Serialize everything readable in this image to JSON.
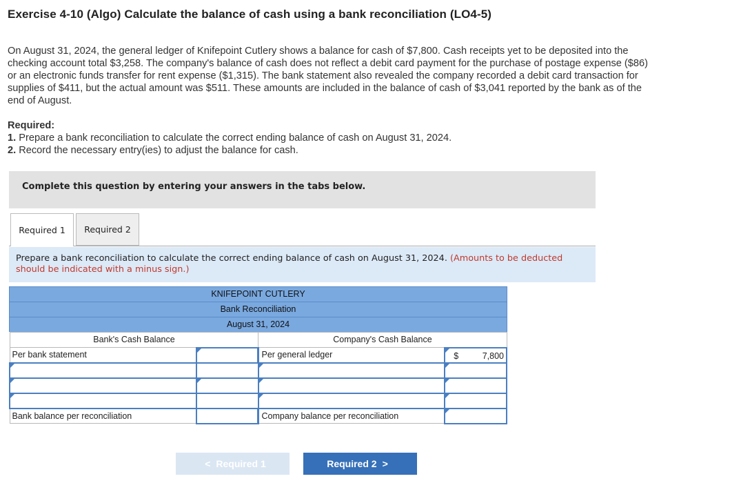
{
  "title": "Exercise 4-10 (Algo) Calculate the balance of cash using a bank reconciliation (LO4-5)",
  "problem_text": "On August 31, 2024, the general ledger of Knifepoint Cutlery shows a balance for cash of $7,800. Cash receipts yet to be deposited into the checking account total $3,258. The company's balance of cash does not reflect a debit card payment for the purchase of postage expense ($86) or an electronic funds transfer for rent expense ($1,315). The bank statement also revealed the company recorded a debit card transaction for supplies of $411, but the actual amount was $511. These amounts are included in the balance of cash of $3,041 reported by the bank as of the end of August.",
  "required": {
    "heading": "Required:",
    "item1_num": "1.",
    "item1": "Prepare a bank reconciliation to calculate the correct ending balance of cash on August 31, 2024.",
    "item2_num": "2.",
    "item2": "Record the necessary entry(ies) to adjust the balance for cash."
  },
  "banner": "Complete this question by entering your answers in the tabs below.",
  "tabs": [
    {
      "label": "Required 1"
    },
    {
      "label": "Required 2"
    }
  ],
  "instruction": {
    "text": "Prepare a bank reconciliation to calculate the correct ending balance of cash on August 31, 2024.",
    "note": "(Amounts to be deducted should be indicated with a minus sign.)"
  },
  "reconciliation": {
    "company": "KNIFEPOINT CUTLERY",
    "heading": "Bank Reconciliation",
    "date": "August 31, 2024",
    "bank_col": "Bank's Cash Balance",
    "company_col": "Company's Cash Balance",
    "bank_first_label": "Per bank statement",
    "company_first_label": "Per general ledger",
    "company_first_currency": "$",
    "company_first_value": "7,800",
    "bank_total_label": "Bank balance per reconciliation",
    "company_total_label": "Company balance per reconciliation"
  },
  "nav": {
    "prev": "Required 1",
    "next": "Required 2",
    "prev_chev": "<",
    "next_chev": ">"
  },
  "colors": {
    "header_blue": "#7aa9e0",
    "input_border": "#4a7fc1",
    "next_button": "#3670b8",
    "note_red": "#c0392b"
  }
}
